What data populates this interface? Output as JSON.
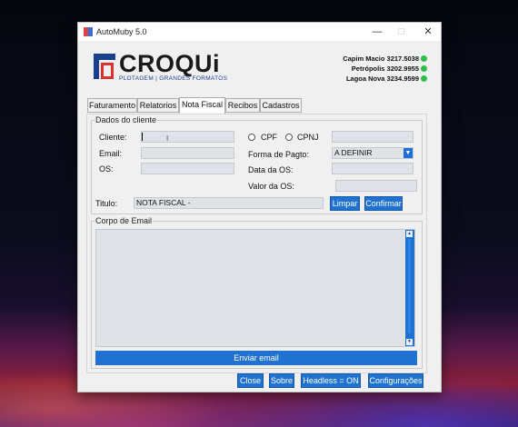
{
  "window": {
    "title": "AutoMuby 5.0",
    "minimize": "—",
    "maximize": "□",
    "close": "✕"
  },
  "brand": {
    "name": "CROQUi",
    "tagline": "PLOTAGEM | GRANDES FORMATOS",
    "accent": "#1b3f8f",
    "logo_red": "#e0322c"
  },
  "contacts": [
    {
      "label": "Capim Macio 3217.5038"
    },
    {
      "label": "Petrópolis 3202.9955"
    },
    {
      "label": "Lagoa Nova 3234.9599"
    }
  ],
  "tabs": [
    {
      "label": "Faturamento",
      "active": false
    },
    {
      "label": "Relatorios",
      "active": false
    },
    {
      "label": "Nota Fiscal",
      "active": true
    },
    {
      "label": "Recibos",
      "active": false
    },
    {
      "label": "Cadastros",
      "active": false
    }
  ],
  "dados": {
    "title": "Dados do cliente",
    "cliente_label": "Cliente:",
    "cliente_value": "",
    "email_label": "Email:",
    "email_value": "",
    "os_label": "OS:",
    "os_value": "",
    "cpf_label": "CPF",
    "cpnj_label": "CPNJ",
    "doc_value": "",
    "pagto_label": "Forma de Pagto:",
    "pagto_value": "A DEFINIR",
    "data_os_label": "Data da OS:",
    "data_os_value": "",
    "valor_os_label": "Valor da OS:",
    "valor_os_value": "",
    "titulo_label": "Titulo:",
    "titulo_value": "NOTA FISCAL -",
    "limpar_label": "Limpar",
    "confirmar_label": "Confirmar"
  },
  "corpo": {
    "title": "Corpo de Email",
    "body_value": "",
    "send_label": "Enviar email"
  },
  "footer": {
    "close_label": "Close",
    "sobre_label": "Sobre",
    "headless_label": "Headless = ON",
    "config_label": "Configurações"
  },
  "colors": {
    "button": "#1f72cf",
    "field": "#dfe3e8",
    "whatsapp": "#2fbf4a"
  }
}
